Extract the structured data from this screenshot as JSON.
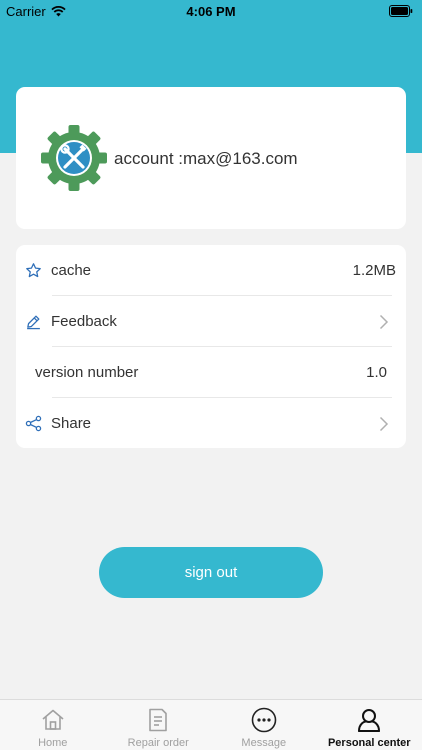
{
  "status": {
    "carrier": "Carrier",
    "time": "4:06 PM"
  },
  "profile": {
    "account_text": "account :max@163.com"
  },
  "menu": {
    "cache": {
      "label": "cache",
      "value": "1.2MB"
    },
    "feedback": {
      "label": "Feedback"
    },
    "version": {
      "label": "version number",
      "value": "1.0"
    },
    "share": {
      "label": "Share"
    }
  },
  "actions": {
    "sign_out_label": "sign out"
  },
  "tabs": [
    {
      "label": "Home",
      "icon": "home-icon"
    },
    {
      "label": "Repair order",
      "icon": "document-icon"
    },
    {
      "label": "Message",
      "icon": "message-icon"
    },
    {
      "label": "Personal center",
      "icon": "person-icon"
    }
  ],
  "colors": {
    "accent": "#35b8cf",
    "background": "#f2f2f2",
    "gear": "#4d9a5a"
  }
}
